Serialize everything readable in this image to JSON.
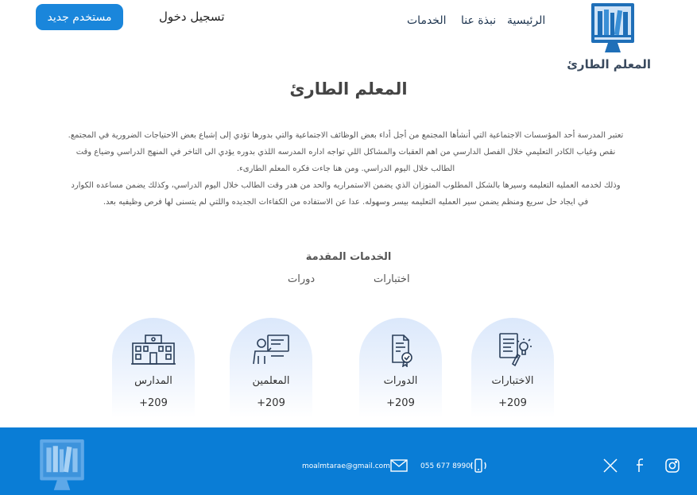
{
  "header": {
    "logo_text": "المعلم الطارئ",
    "nav": [
      {
        "label": "الرئيسية"
      },
      {
        "label": "نبذة عنا"
      },
      {
        "label": "الخدمات"
      }
    ],
    "login_label": "تسجيل دخول",
    "new_user_label": "مستخدم جديد"
  },
  "main": {
    "title": "المعلم الطارئ",
    "paragraph_lines": [
      "تعتبر المدرسة أحد المؤسسات الاجتماعية التي أنشأها المجتمع من أجل أداء بعض الوظائف الاجتماعية والتي بدورها تؤدي إلى إشباع بعض الاحتياجات الضرورية في المجتمع.",
      "نقص وغياب الكادر التعليمي خلال الفصل الدارسي من اهم العقبات والمشاكل اللي تواجه اداره المدرسه   اللذي بدوره يؤدي الى التاخر في المنهج الدراسي وضياع وقت",
      "الطالب خلال اليوم الدراسي. ومن هنا جاءت فكره المعلم الطارىء.",
      "وذلك لخدمه العمليه التعليمه وسيرها بالشكل المطلوب المتوزان الذي يضمن الاستمراريه والحد من هدر وقت الطالب خلال اليوم الدراسي، وكذلك  يضمن مساعده الكوارد",
      "في ايجاد حل سريع ومنظم  يضمن سير العمليه التعليمه بيسر وسهوله. عدا عن  الاستفاده من الكفاءات   الجديده واللتي لم  يتسنى لها فرص وظيفيه بعد."
    ],
    "services_title": "الخدمات المقدمة",
    "tabs": [
      {
        "label": "اختبارات"
      },
      {
        "label": "دورات"
      }
    ],
    "cards": [
      {
        "label": "الاختبارات",
        "count": "+209",
        "icon": "exam-icon"
      },
      {
        "label": "الدورات",
        "count": "+209",
        "icon": "certificate-icon"
      },
      {
        "label": "المعلمين",
        "count": "+209",
        "icon": "teacher-icon"
      },
      {
        "label": "المدارس",
        "count": "+209",
        "icon": "school-building-icon"
      }
    ]
  },
  "footer": {
    "email": "moalmtarae@gmail.com",
    "phone": "055 677 8990",
    "social": [
      "instagram-icon",
      "facebook-icon",
      "x-icon"
    ]
  },
  "colors": {
    "primary": "#1a86db",
    "footer_bg": "#0a7dd6",
    "card_gradient_top": "#dbe8fb",
    "text_dark": "#333333"
  }
}
